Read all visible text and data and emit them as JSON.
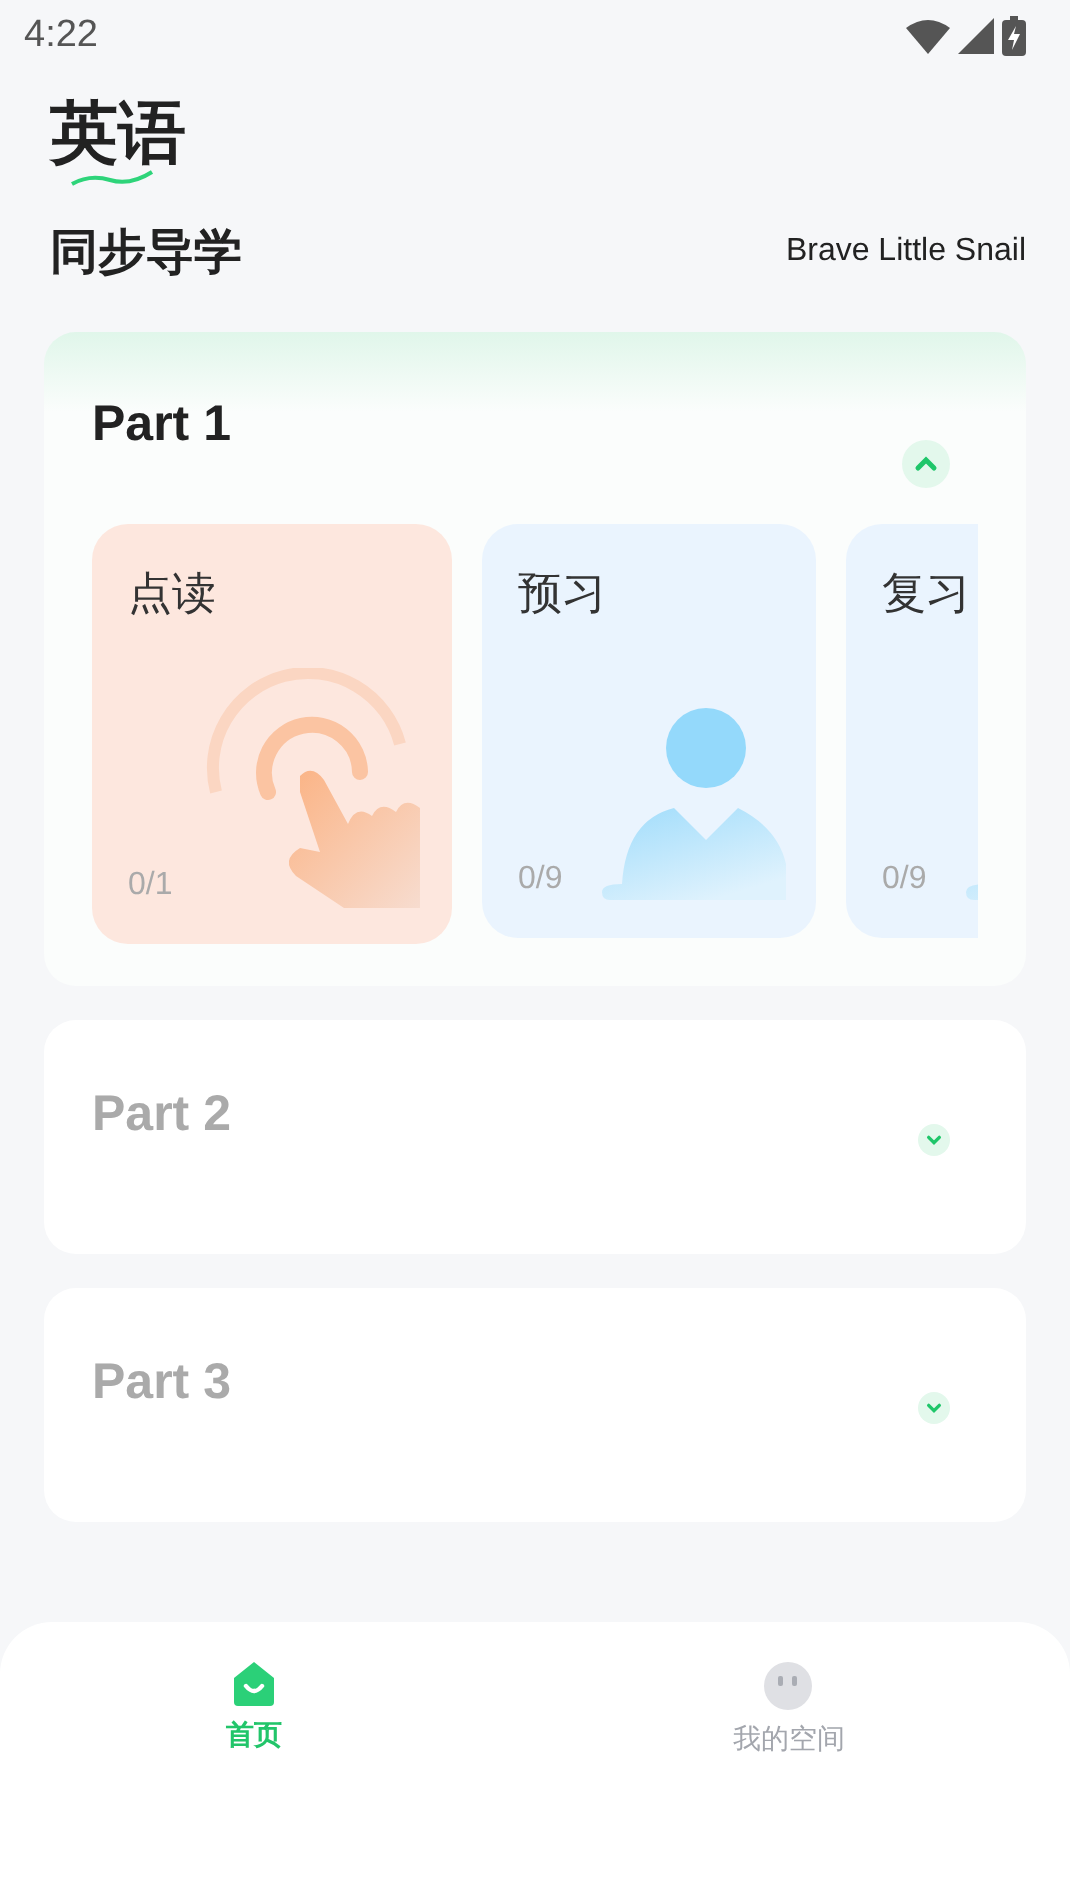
{
  "status_bar": {
    "time": "4:22"
  },
  "header": {
    "title": "英语",
    "subtitle": "同步导学",
    "book": "Brave Little Snail"
  },
  "parts": [
    {
      "title": "Part 1",
      "expanded": true,
      "activities": [
        {
          "label": "点读",
          "progress": "0/1",
          "kind": "tap"
        },
        {
          "label": "预习",
          "progress": "0/9",
          "kind": "person"
        },
        {
          "label": "复习",
          "progress": "0/9",
          "kind": "person"
        }
      ]
    },
    {
      "title": "Part 2",
      "expanded": false
    },
    {
      "title": "Part 3",
      "expanded": false
    }
  ],
  "tabs": [
    {
      "label": "首页",
      "selected": true,
      "kind": "home"
    },
    {
      "label": "我的空间",
      "selected": false,
      "kind": "space"
    }
  ]
}
